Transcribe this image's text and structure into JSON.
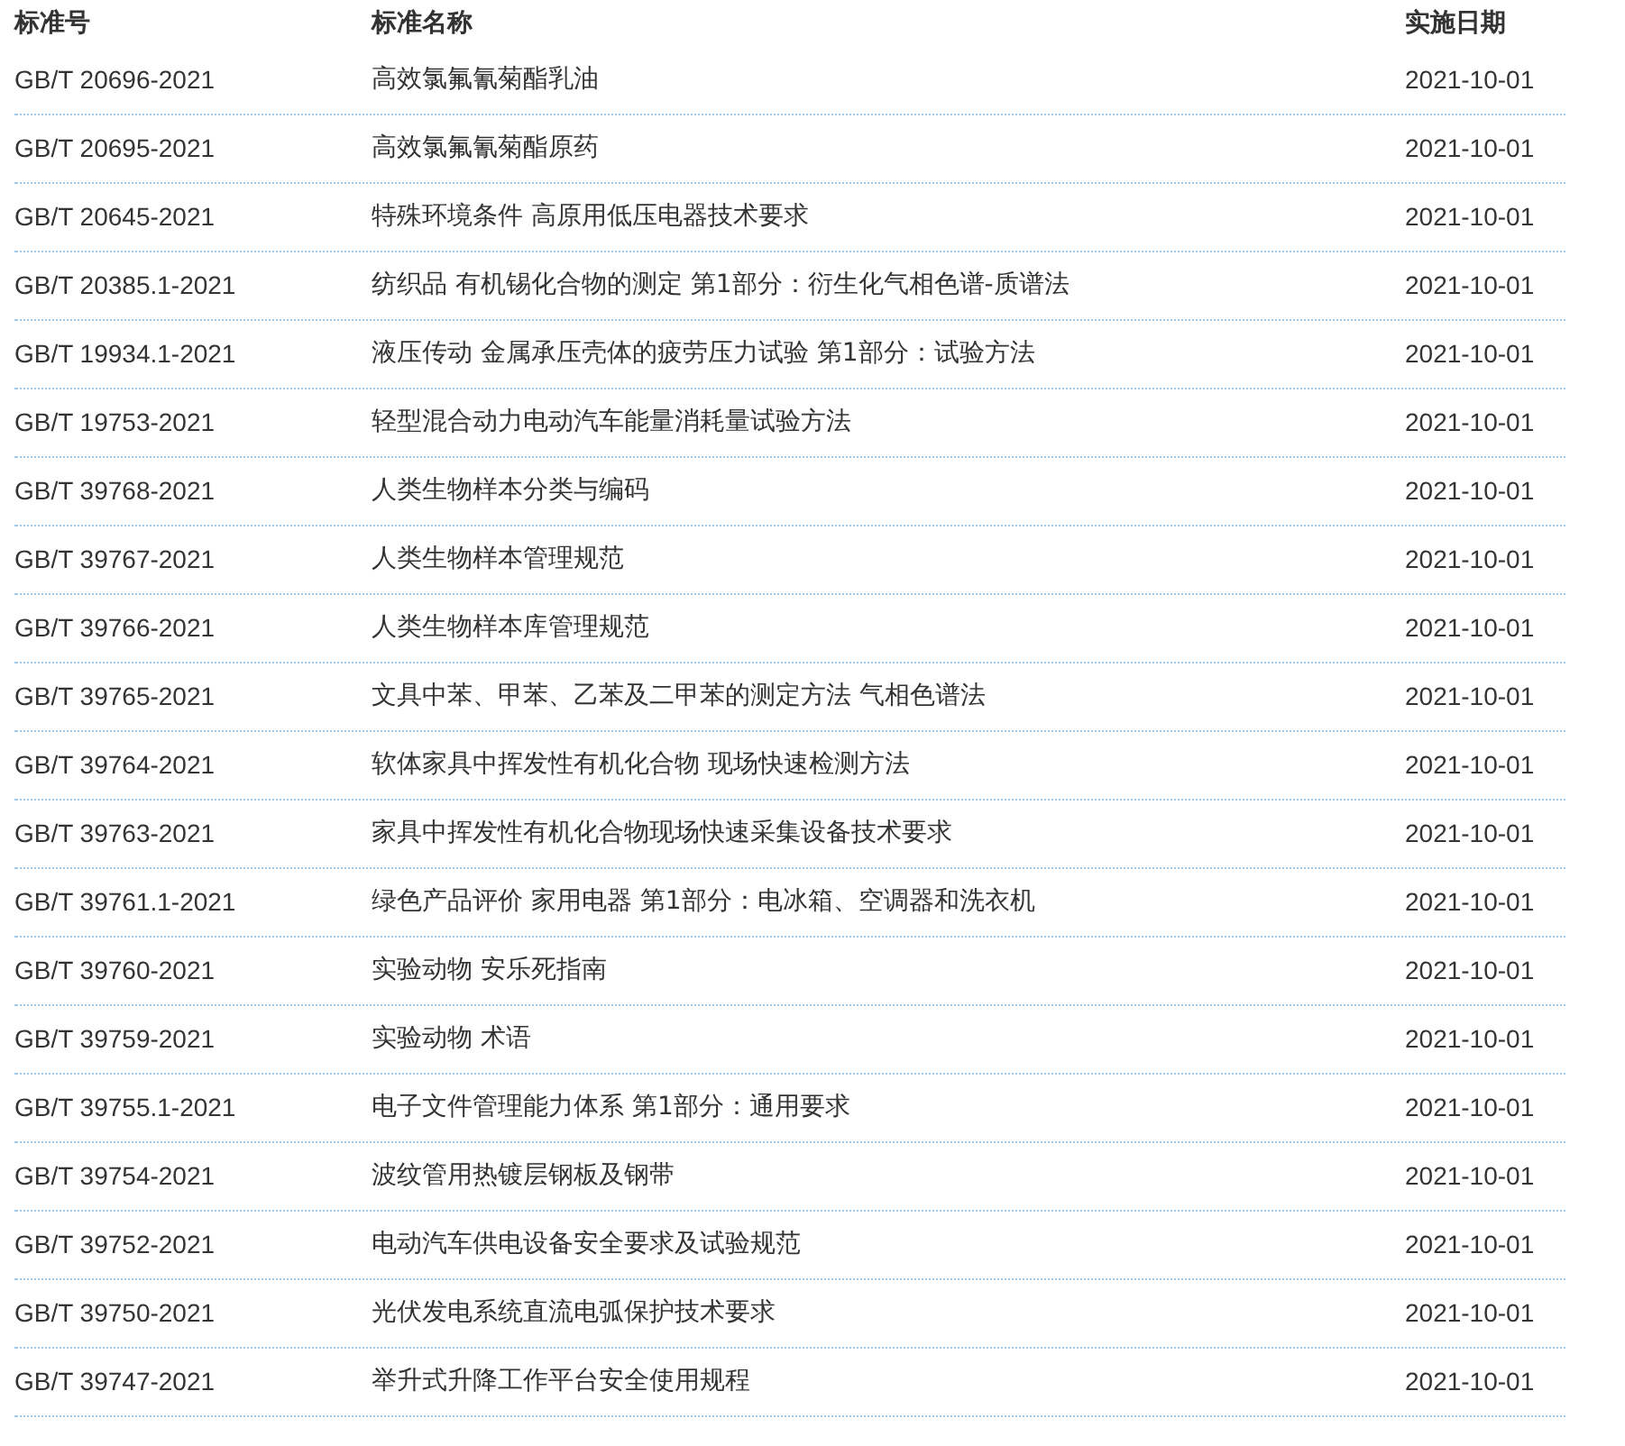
{
  "table": {
    "columns": [
      "标准号",
      "标准名称",
      "实施日期"
    ],
    "rows": [
      [
        "GB/T 20696-2021",
        "高效氯氟氰菊酯乳油",
        "2021-10-01"
      ],
      [
        "GB/T 20695-2021",
        "高效氯氟氰菊酯原药",
        "2021-10-01"
      ],
      [
        "GB/T 20645-2021",
        "特殊环境条件 高原用低压电器技术要求",
        "2021-10-01"
      ],
      [
        "GB/T 20385.1-2021",
        "纺织品 有机锡化合物的测定 第1部分：衍生化气相色谱-质谱法",
        "2021-10-01"
      ],
      [
        "GB/T 19934.1-2021",
        "液压传动 金属承压壳体的疲劳压力试验 第1部分：试验方法",
        "2021-10-01"
      ],
      [
        "GB/T 19753-2021",
        "轻型混合动力电动汽车能量消耗量试验方法",
        "2021-10-01"
      ],
      [
        "GB/T 39768-2021",
        "人类生物样本分类与编码",
        "2021-10-01"
      ],
      [
        "GB/T 39767-2021",
        "人类生物样本管理规范",
        "2021-10-01"
      ],
      [
        "GB/T 39766-2021",
        "人类生物样本库管理规范",
        "2021-10-01"
      ],
      [
        "GB/T 39765-2021",
        "文具中苯、甲苯、乙苯及二甲苯的测定方法 气相色谱法",
        "2021-10-01"
      ],
      [
        "GB/T 39764-2021",
        "软体家具中挥发性有机化合物 现场快速检测方法",
        "2021-10-01"
      ],
      [
        "GB/T 39763-2021",
        "家具中挥发性有机化合物现场快速采集设备技术要求",
        "2021-10-01"
      ],
      [
        "GB/T 39761.1-2021",
        "绿色产品评价 家用电器 第1部分：电冰箱、空调器和洗衣机",
        "2021-10-01"
      ],
      [
        "GB/T 39760-2021",
        "实验动物 安乐死指南",
        "2021-10-01"
      ],
      [
        "GB/T 39759-2021",
        "实验动物 术语",
        "2021-10-01"
      ],
      [
        "GB/T 39755.1-2021",
        "电子文件管理能力体系 第1部分：通用要求",
        "2021-10-01"
      ],
      [
        "GB/T 39754-2021",
        "波纹管用热镀层钢板及钢带",
        "2021-10-01"
      ],
      [
        "GB/T 39752-2021",
        "电动汽车供电设备安全要求及试验规范",
        "2021-10-01"
      ],
      [
        "GB/T 39750-2021",
        "光伏发电系统直流电弧保护技术要求",
        "2021-10-01"
      ],
      [
        "GB/T 39747-2021",
        "举升式升降工作平台安全使用规程",
        "2021-10-01"
      ]
    ]
  }
}
